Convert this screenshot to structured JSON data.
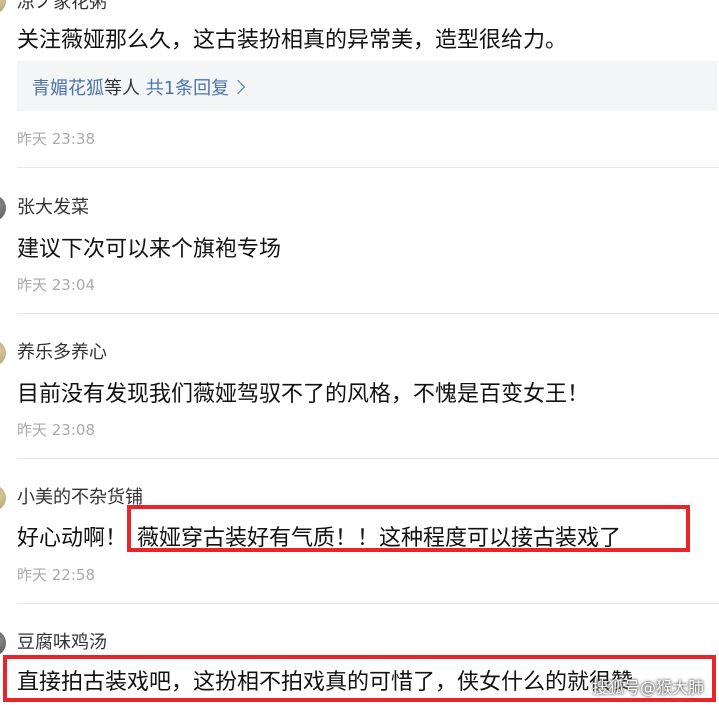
{
  "comments": [
    {
      "username": "凉ノ家花粥",
      "text": "关注薇娅那么久，这古装扮相真的异常美，造型很给力。",
      "reply_users": "青媚花狐",
      "reply_mid": "等人",
      "reply_count": "共1条回复",
      "time": "昨天 23:38"
    },
    {
      "username": "张大发菜",
      "text": "建议下次可以来个旗袍专场",
      "time": "昨天 23:04"
    },
    {
      "username": "养乐多养心",
      "text": "目前没有发现我们薇娅驾驭不了的风格，不愧是百变女王！",
      "time": "昨天 23:08"
    },
    {
      "username": "小美的不杂货铺",
      "text_prefix": "好心动啊！",
      "text_highlight": "薇娅穿古装好有气质！！这种程度可以接古装戏了",
      "time": "昨天 22:58"
    },
    {
      "username": "豆腐味鸡汤",
      "text": "直接拍古装戏吧，这扮相不拍戏真的可惜了，侠女什么的就很赞"
    }
  ],
  "watermark": "搜狐号@猴大肺",
  "colors": {
    "highlight": "#e8252b",
    "link": "#4a76ad",
    "time": "#aaaaaa"
  }
}
